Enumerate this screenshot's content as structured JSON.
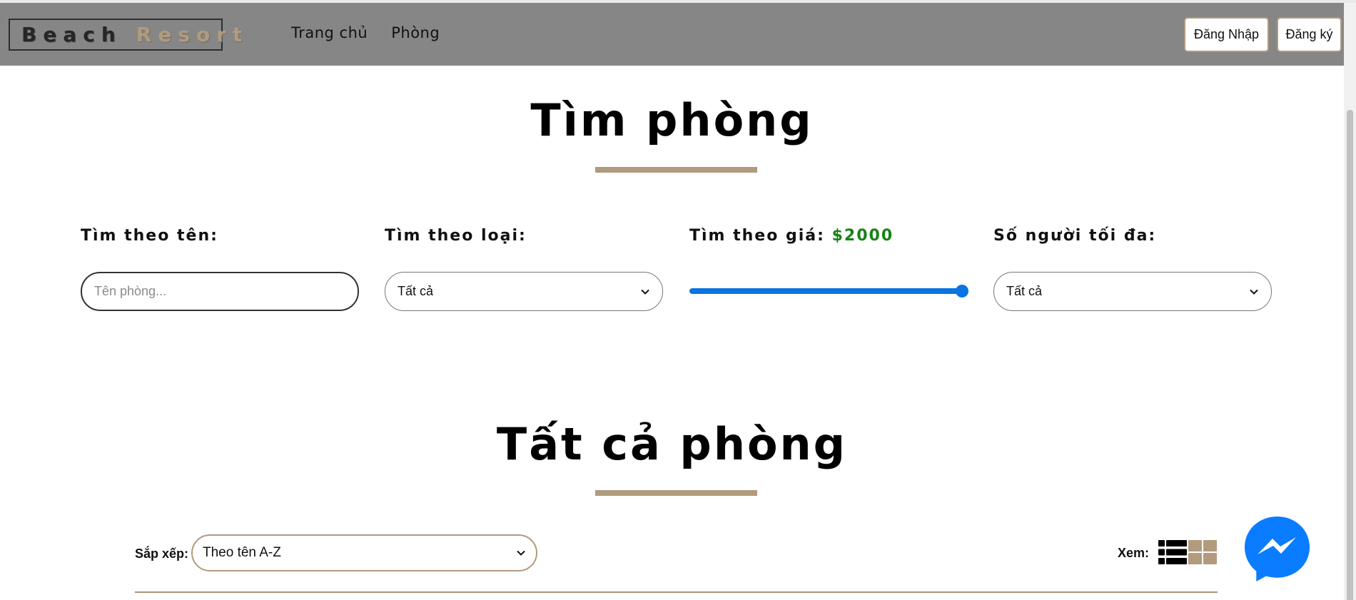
{
  "navbar": {
    "logo_word1": "Beach",
    "logo_word2": "Resort",
    "links": [
      "Trang chủ",
      "Phòng"
    ],
    "login_label": "Đăng Nhập",
    "register_label": "Đăng ký"
  },
  "search_section": {
    "title": "Tìm phòng",
    "name_filter": {
      "label": "Tìm theo tên:",
      "placeholder": "Tên phòng...",
      "value": ""
    },
    "type_filter": {
      "label": "Tìm theo loại:",
      "selected": "Tất cả"
    },
    "price_filter": {
      "label": "Tìm theo giá:",
      "value_text": "$2000",
      "slider_fraction": 1.0
    },
    "guests_filter": {
      "label": "Số người tối đa:",
      "selected": "Tất cả"
    }
  },
  "rooms_section": {
    "title": "Tất cả phòng",
    "sort_label": "Sắp xếp:",
    "sort_selected": "Theo tên A-Z",
    "view_label": "Xem:",
    "view_mode": "list"
  },
  "colors": {
    "navbar_bg": "#868686",
    "accent": "#b29a7d",
    "price_green": "#168216",
    "slider_blue": "#0a74e0",
    "messenger_blue": "#0a7cff"
  },
  "icons": [
    "chevron-down-icon",
    "list-view-icon",
    "grid-view-icon",
    "messenger-icon"
  ]
}
